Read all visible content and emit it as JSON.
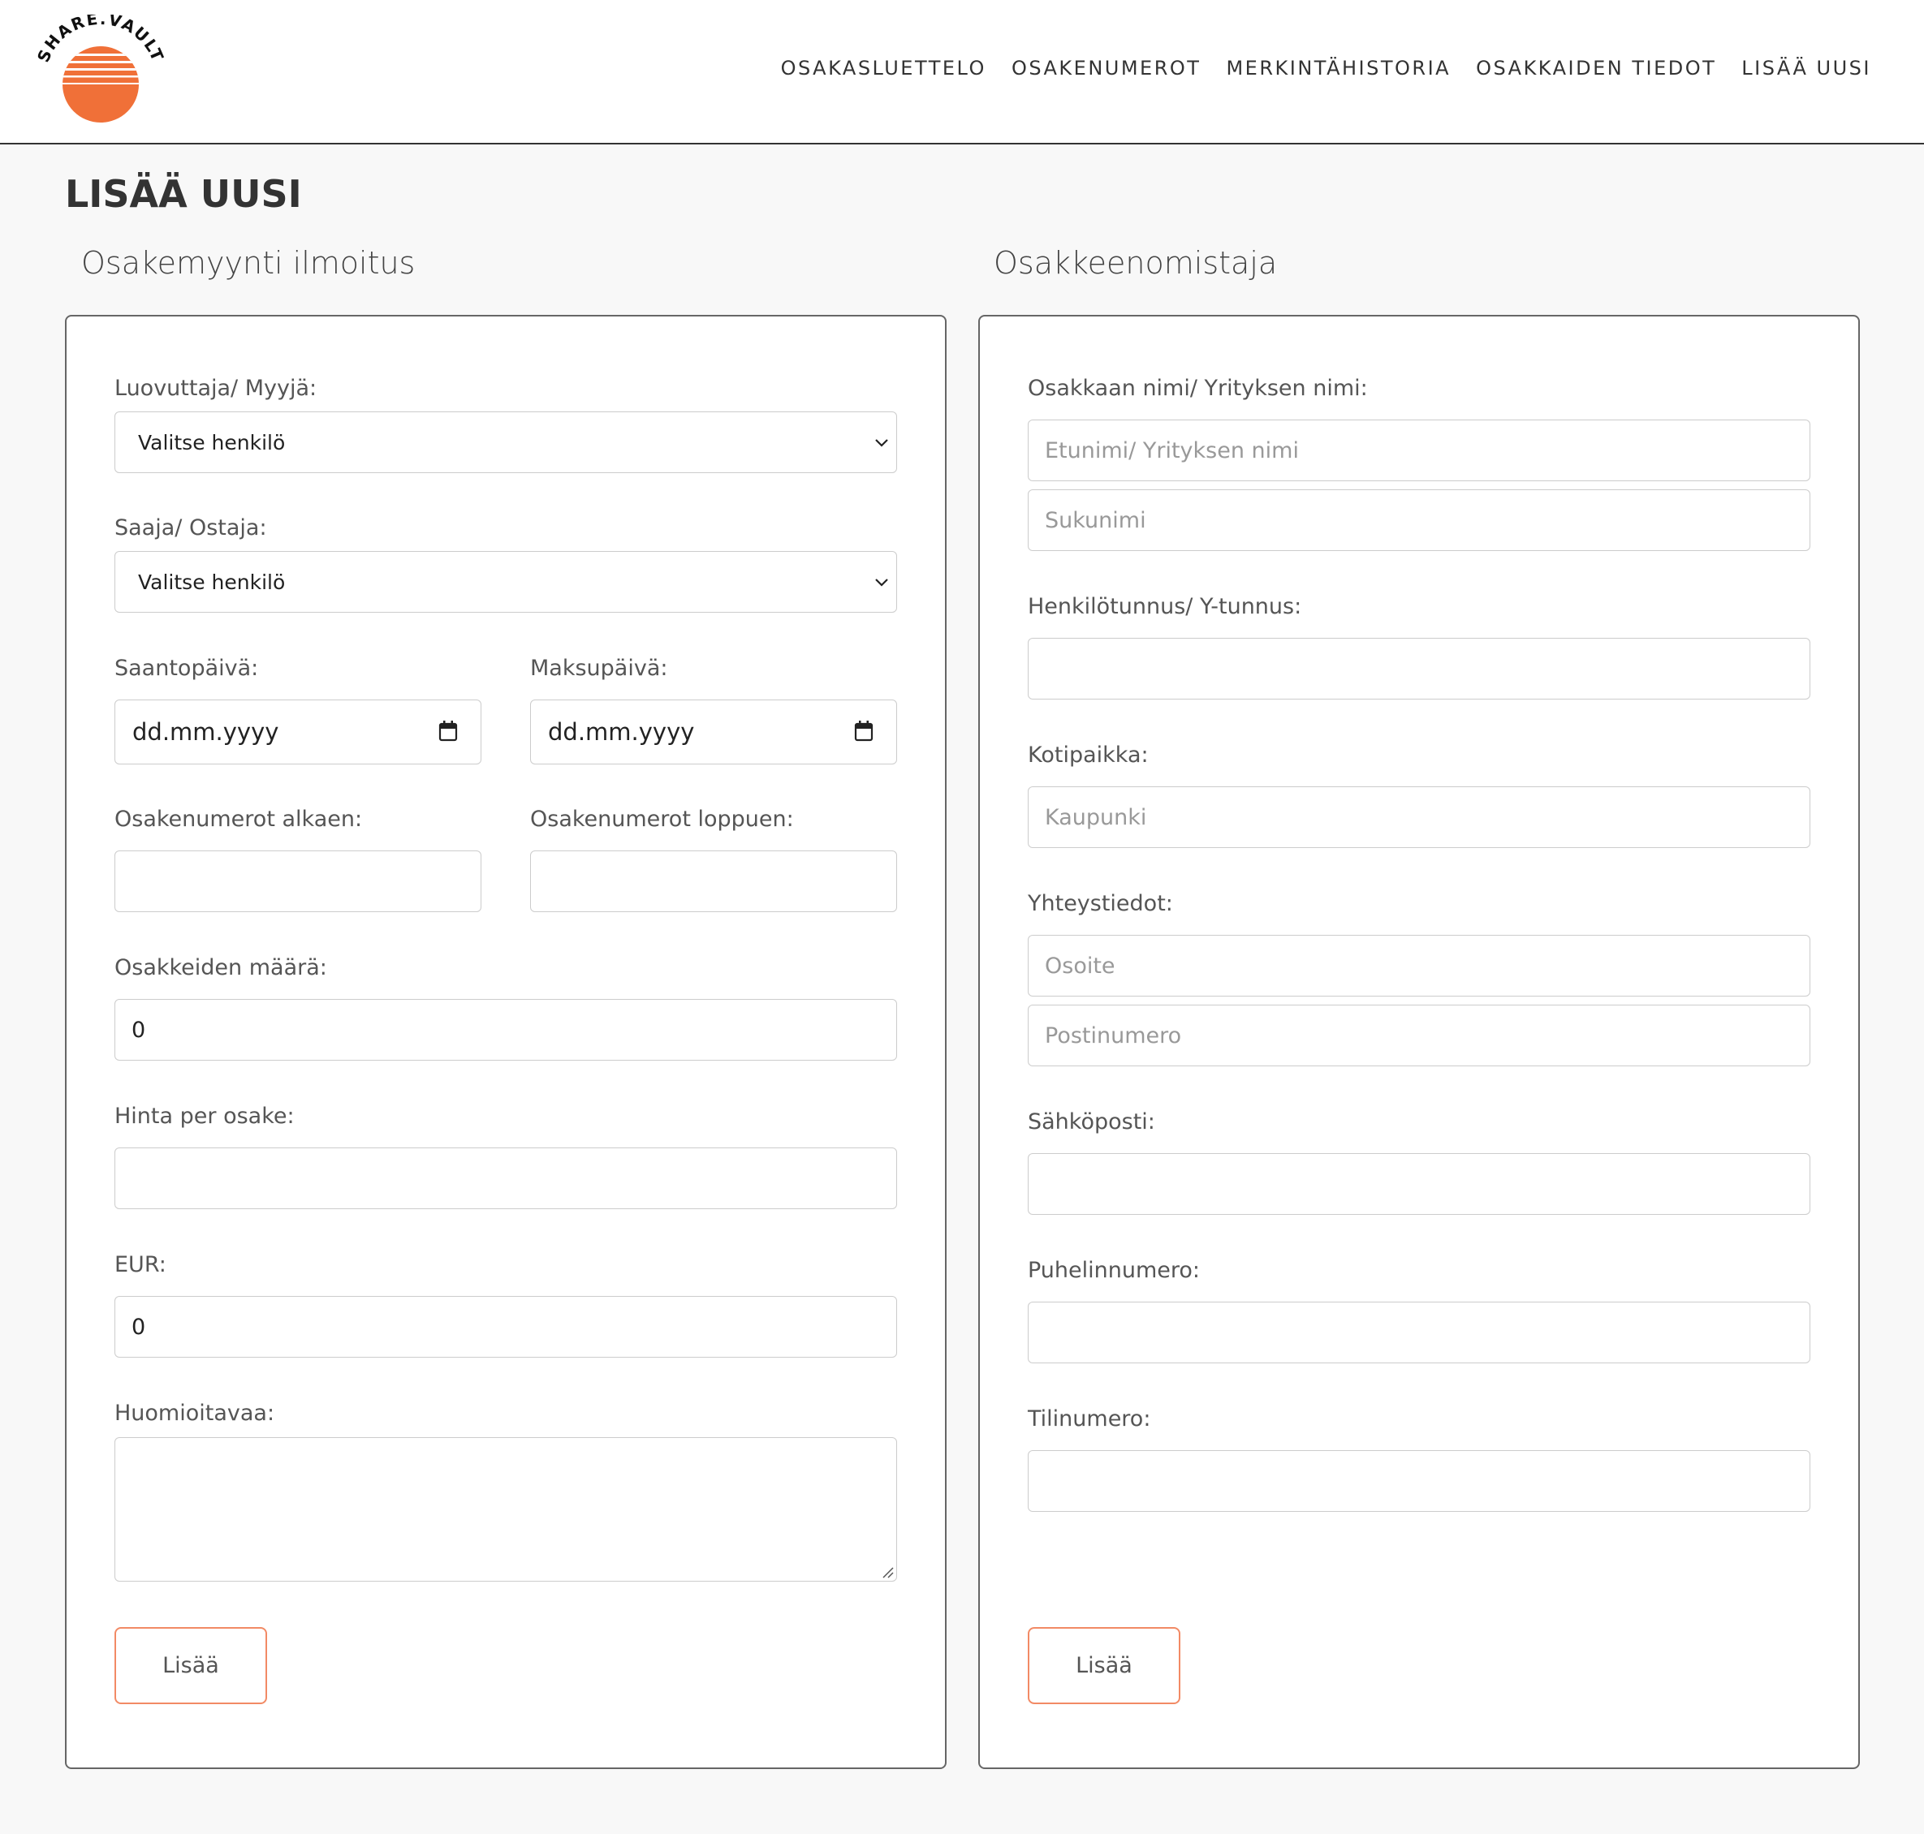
{
  "brand": {
    "logo_text": "SHARE.VAULT",
    "logo_color": "#f07038"
  },
  "nav": {
    "items": [
      "OSAKASLUETTELO",
      "OSAKENUMEROT",
      "MERKINTÄHISTORIA",
      "OSAKKAIDEN TIEDOT",
      "LISÄÄ UUSI"
    ]
  },
  "page_title": "LISÄÄ UUSI",
  "sale_form": {
    "title": "Osakemyynti ilmoitus",
    "seller_label": "Luovuttaja/ Myyjä:",
    "seller_value": "Valitse henkilö",
    "buyer_label": "Saaja/ Ostaja:",
    "buyer_value": "Valitse henkilö",
    "acquisition_date_label": "Saantopäivä:",
    "acquisition_date_placeholder": "dd.mm.yyyy",
    "payment_date_label": "Maksupäivä:",
    "payment_date_placeholder": "dd.mm.yyyy",
    "share_start_label": "Osakenumerot alkaen:",
    "share_start_value": "",
    "share_end_label": "Osakenumerot loppuen:",
    "share_end_value": "",
    "share_count_label": "Osakkeiden määrä:",
    "share_count_value": "0",
    "price_label": "Hinta per osake:",
    "price_value": "",
    "eur_label": "EUR:",
    "eur_value": "0",
    "notes_label": "Huomioitavaa:",
    "notes_value": "",
    "submit_label": "Lisää"
  },
  "owner_form": {
    "title": "Osakkeenomistaja",
    "name_label": "Osakkaan nimi/ Yrityksen nimi:",
    "first_name_placeholder": "Etunimi/ Yrityksen nimi",
    "last_name_placeholder": "Sukunimi",
    "id_label": "Henkilötunnus/ Y-tunnus:",
    "id_value": "",
    "domicile_label": "Kotipaikka:",
    "domicile_placeholder": "Kaupunki",
    "contact_label": "Yhteystiedot:",
    "address_placeholder": "Osoite",
    "postal_placeholder": "Postinumero",
    "email_label": "Sähköposti:",
    "email_value": "",
    "phone_label": "Puhelinnumero:",
    "phone_value": "",
    "account_label": "Tilinumero:",
    "account_value": "",
    "submit_label": "Lisää"
  },
  "colors": {
    "accent": "#f28a65",
    "heading": "#333333",
    "label": "#555555"
  }
}
